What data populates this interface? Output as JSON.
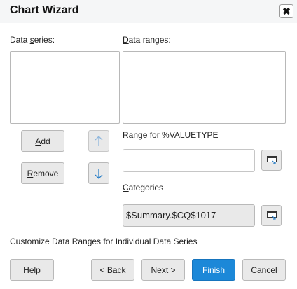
{
  "window": {
    "title": "Chart Wizard",
    "close_glyph": "✖"
  },
  "labels": {
    "data_series_pre": "Data ",
    "data_series_mnemonic": "s",
    "data_series_post": "eries:",
    "data_ranges_mnemonic": "D",
    "data_ranges_post": "ata ranges:",
    "range_for": "Range for %VALUETYPE",
    "categories_mnemonic": "C",
    "categories_post": "ategories",
    "customize": "Customize Data Ranges for Individual Data Series"
  },
  "buttons": {
    "add_mnemonic": "A",
    "add_post": "dd",
    "remove_mnemonic": "R",
    "remove_post": "emove",
    "help_mnemonic": "H",
    "help_post": "elp",
    "back_pre": "< Bac",
    "back_mnemonic": "k",
    "next_mnemonic": "N",
    "next_post": "ext >",
    "finish_mnemonic": "F",
    "finish_post": "inish",
    "cancel_mnemonic": "C",
    "cancel_post": "ancel"
  },
  "fields": {
    "range_value": "",
    "categories_value": "$Summary.$CQ$1017"
  },
  "icons": {
    "move_up": "arrow-up-icon",
    "move_down": "arrow-down-icon",
    "range_select": "select-range-icon",
    "close": "close-icon"
  },
  "colors": {
    "primary_button": "#1c88d8",
    "arrow_disabled": "#2b7fc7"
  }
}
